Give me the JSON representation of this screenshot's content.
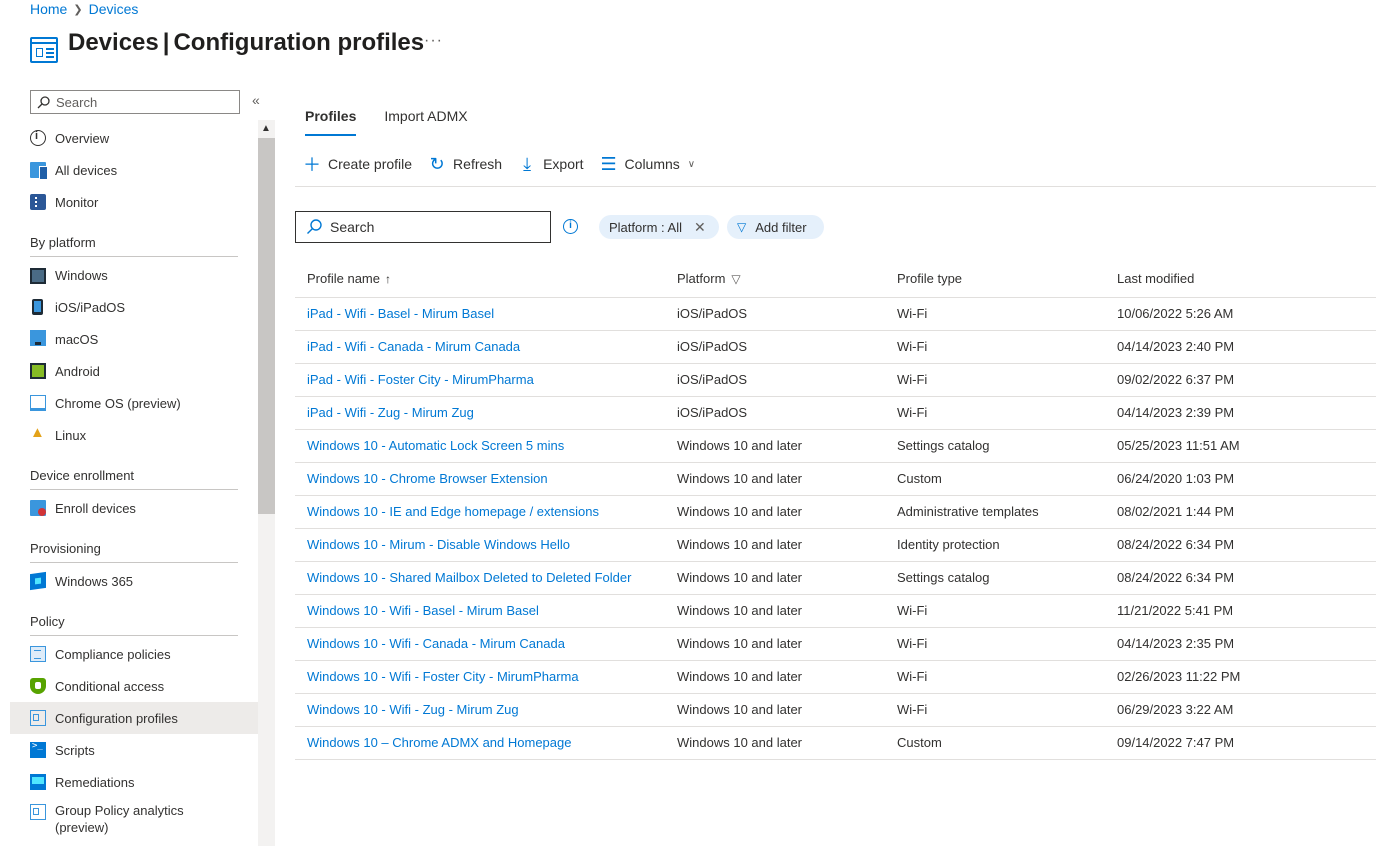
{
  "breadcrumb": {
    "home": "Home",
    "devices": "Devices"
  },
  "header": {
    "title_strong": "Devices",
    "separator": "|",
    "title_rest": "Configuration profiles",
    "more": "···"
  },
  "sidebar": {
    "search_placeholder": "Search",
    "collapse": "«",
    "items_top": [
      {
        "label": "Overview",
        "icon": "info-icon"
      },
      {
        "label": "All devices",
        "icon": "devices-icon"
      },
      {
        "label": "Monitor",
        "icon": "monitor-icon"
      }
    ],
    "sections": {
      "by_platform": "By platform",
      "device_enrollment": "Device enrollment",
      "provisioning": "Provisioning",
      "policy": "Policy"
    },
    "platform_items": [
      {
        "label": "Windows",
        "icon": "windows-icon"
      },
      {
        "label": "iOS/iPadOS",
        "icon": "ios-icon"
      },
      {
        "label": "macOS",
        "icon": "macos-icon"
      },
      {
        "label": "Android",
        "icon": "android-icon"
      },
      {
        "label": "Chrome OS (preview)",
        "icon": "chrome-os-icon"
      },
      {
        "label": "Linux",
        "icon": "linux-icon"
      }
    ],
    "enrollment_items": [
      {
        "label": "Enroll devices",
        "icon": "enroll-icon"
      }
    ],
    "provisioning_items": [
      {
        "label": "Windows 365",
        "icon": "windows-365-icon"
      }
    ],
    "policy_items": [
      {
        "label": "Compliance policies",
        "icon": "compliance-icon"
      },
      {
        "label": "Conditional access",
        "icon": "conditional-access-icon"
      },
      {
        "label": "Configuration profiles",
        "icon": "configuration-profiles-icon",
        "active": true
      },
      {
        "label": "Scripts",
        "icon": "scripts-icon"
      },
      {
        "label": "Remediations",
        "icon": "remediations-icon"
      },
      {
        "label": "Group Policy analytics (preview)",
        "icon": "group-policy-icon"
      }
    ]
  },
  "tabs": {
    "profiles": "Profiles",
    "import_admx": "Import ADMX"
  },
  "toolbar": {
    "create": "Create profile",
    "refresh": "Refresh",
    "export": "Export",
    "columns": "Columns"
  },
  "filters": {
    "search_placeholder": "Search",
    "platform_pill": "Platform : All",
    "add_filter": "Add filter"
  },
  "table": {
    "columns": {
      "name": "Profile name",
      "platform": "Platform",
      "type": "Profile type",
      "modified": "Last modified"
    },
    "rows": [
      {
        "name": "iPad - Wifi - Basel - Mirum Basel",
        "platform": "iOS/iPadOS",
        "type": "Wi-Fi",
        "modified": "10/06/2022 5:26 AM"
      },
      {
        "name": "iPad - Wifi - Canada - Mirum Canada",
        "platform": "iOS/iPadOS",
        "type": "Wi-Fi",
        "modified": "04/14/2023 2:40 PM"
      },
      {
        "name": "iPad - Wifi - Foster City - MirumPharma",
        "platform": "iOS/iPadOS",
        "type": "Wi-Fi",
        "modified": "09/02/2022 6:37 PM"
      },
      {
        "name": "iPad - Wifi - Zug - Mirum Zug",
        "platform": "iOS/iPadOS",
        "type": "Wi-Fi",
        "modified": "04/14/2023 2:39 PM"
      },
      {
        "name": "Windows 10 - Automatic Lock Screen 5 mins",
        "platform": "Windows 10 and later",
        "type": "Settings catalog",
        "modified": "05/25/2023 11:51 AM"
      },
      {
        "name": "Windows 10 - Chrome Browser Extension",
        "platform": "Windows 10 and later",
        "type": "Custom",
        "modified": "06/24/2020 1:03 PM"
      },
      {
        "name": "Windows 10 - IE and Edge homepage / extensions",
        "platform": "Windows 10 and later",
        "type": "Administrative templates",
        "modified": "08/02/2021 1:44 PM"
      },
      {
        "name": "Windows 10 - Mirum - Disable Windows Hello",
        "platform": "Windows 10 and later",
        "type": "Identity protection",
        "modified": "08/24/2022 6:34 PM"
      },
      {
        "name": "Windows 10 - Shared Mailbox Deleted to Deleted Folder",
        "platform": "Windows 10 and later",
        "type": "Settings catalog",
        "modified": "08/24/2022 6:34 PM"
      },
      {
        "name": "Windows 10 - Wifi - Basel - Mirum Basel",
        "platform": "Windows 10 and later",
        "type": "Wi-Fi",
        "modified": "11/21/2022 5:41 PM"
      },
      {
        "name": "Windows 10 - Wifi - Canada - Mirum Canada",
        "platform": "Windows 10 and later",
        "type": "Wi-Fi",
        "modified": "04/14/2023 2:35 PM"
      },
      {
        "name": "Windows 10 - Wifi - Foster City - MirumPharma",
        "platform": "Windows 10 and later",
        "type": "Wi-Fi",
        "modified": "02/26/2023 11:22 PM"
      },
      {
        "name": "Windows 10 - Wifi - Zug - Mirum Zug",
        "platform": "Windows 10 and later",
        "type": "Wi-Fi",
        "modified": "06/29/2023 3:22 AM"
      },
      {
        "name": "Windows 10 – Chrome ADMX and Homepage",
        "platform": "Windows 10 and later",
        "type": "Custom",
        "modified": "09/14/2022 7:47 PM"
      }
    ]
  },
  "colors": {
    "accent": "#0078d4",
    "active_nav": "#edebe9",
    "pill_bg": "#e5f0fb"
  }
}
